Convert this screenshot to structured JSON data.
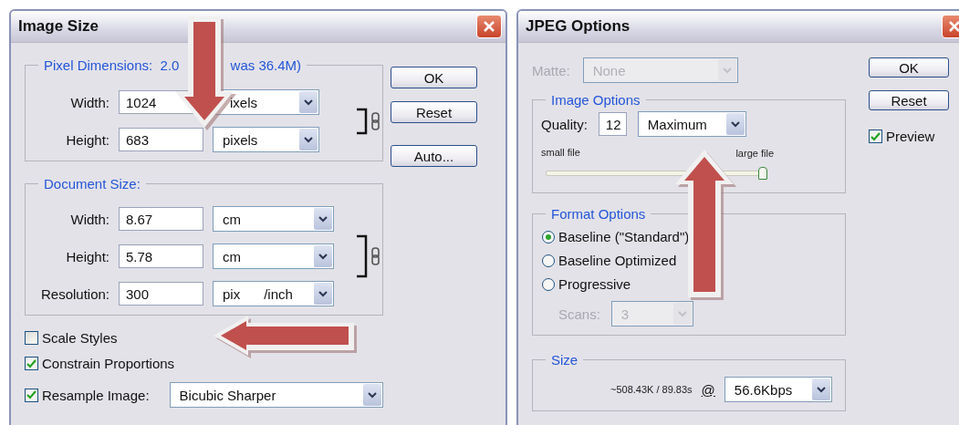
{
  "image_size": {
    "title": "Image Size",
    "pixel_dimensions": {
      "legend_parts": [
        "Pixel Dimensions:  2.0",
        "was 36.4M)"
      ],
      "linked": true,
      "rows": [
        {
          "label": "Width:",
          "value": "1024",
          "unit": [
            "ixels"
          ]
        },
        {
          "label": "Height:",
          "value": "683",
          "unit": [
            "pixels"
          ]
        }
      ]
    },
    "document_size": {
      "legend_parts": [
        "Document Size:"
      ],
      "linked": true,
      "rows": [
        {
          "label": "Width:",
          "value": "8.67",
          "unit": [
            "cm"
          ]
        },
        {
          "label": "Height:",
          "value": "5.78",
          "unit": [
            "cm"
          ]
        },
        {
          "label": "Resolution:",
          "value": "300",
          "unit": [
            "pix",
            "/inch"
          ]
        }
      ]
    },
    "checkboxes": [
      {
        "label": "Scale Styles",
        "checked": false
      },
      {
        "label": "Constrain Proportions",
        "checked": true
      }
    ],
    "resample": {
      "label": "Resample Image:",
      "checked": true,
      "value": "Bicubic Sharper"
    },
    "buttons": [
      "OK",
      "Reset",
      "Auto..."
    ]
  },
  "jpeg_options": {
    "title": "JPEG Options",
    "matte": {
      "label": "Matte:",
      "value": "None",
      "disabled": true
    },
    "image_options": {
      "legend": "Image Options",
      "quality_label": "Quality:",
      "quality": "12",
      "preset": "Maximum",
      "small_label": "small file",
      "large_label": "large file",
      "level": 1
    },
    "format_options": {
      "legend": "Format Options",
      "options": [
        {
          "label": "Baseline (\"Standard\")",
          "selected": true
        },
        {
          "label": "Baseline Optimized",
          "selected": false
        },
        {
          "label": "Progressive",
          "selected": false
        }
      ],
      "scans": {
        "label": "Scans:",
        "value": "3",
        "disabled": true
      }
    },
    "size": {
      "legend": "Size",
      "estimate": "~508.43K / 89.83s",
      "at": "@",
      "speed": "56.6Kbps"
    },
    "buttons": [
      "OK",
      "Reset"
    ],
    "preview": {
      "label": "Preview",
      "checked": true
    }
  },
  "annotations": [
    {
      "kind": "down"
    },
    {
      "kind": "left"
    },
    {
      "kind": "up"
    }
  ]
}
